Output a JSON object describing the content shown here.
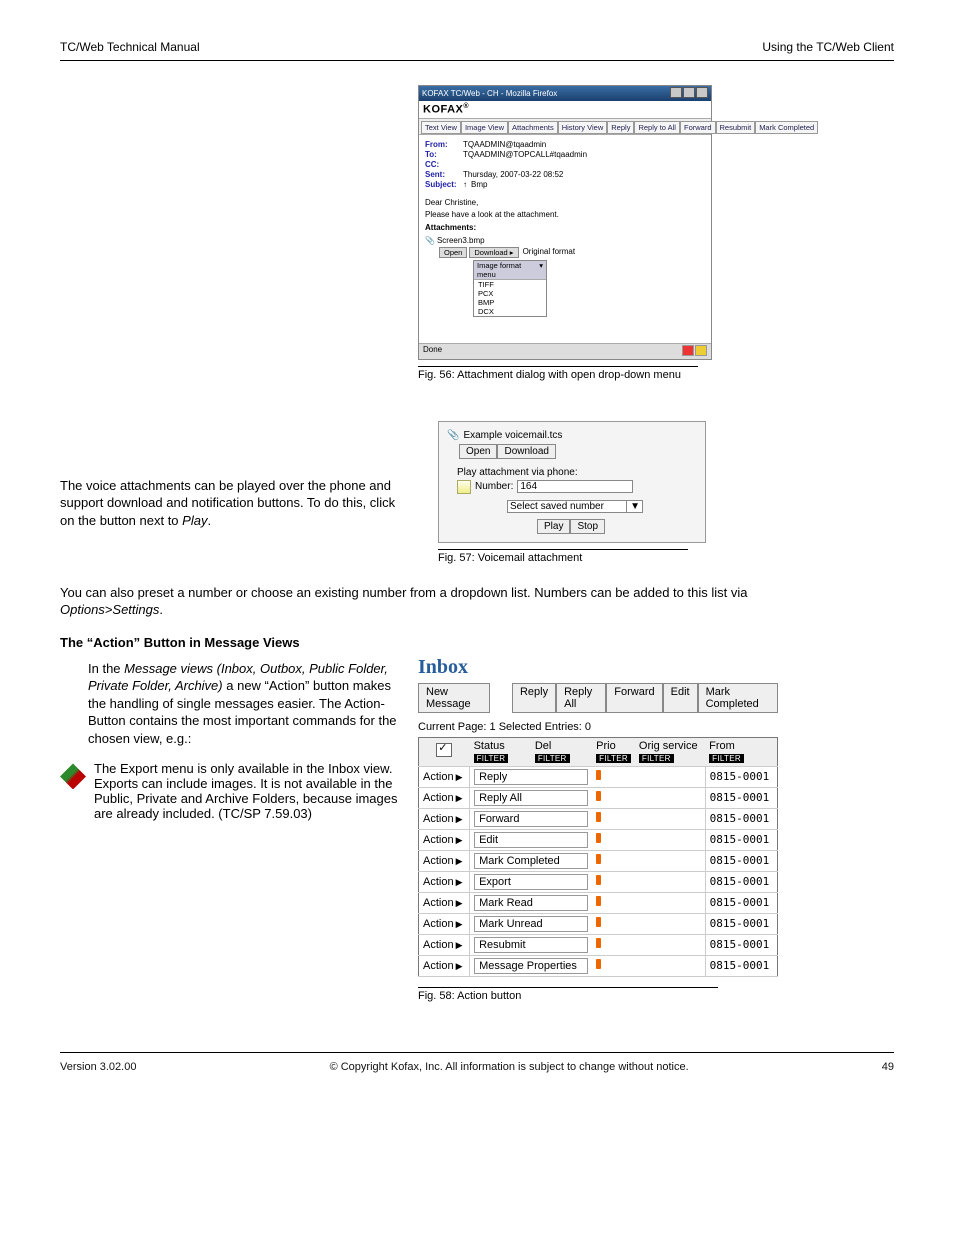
{
  "header": {
    "left": "TC/Web  Technical Manual",
    "right": "Using the TC/Web Client"
  },
  "footer": {
    "left": "Version 3.02.00",
    "center": "© Copyright Kofax, Inc.  All information is subject to change without notice.",
    "right": "49"
  },
  "fig56": {
    "title": "KOFAX TC/Web - CH - Mozilla Firefox",
    "brand": "KOFAX",
    "tabs": [
      "Text View",
      "Image View",
      "Attachments",
      "History View"
    ],
    "actions": [
      "Reply",
      "Reply to All",
      "Forward",
      "Resubmit",
      "Mark Completed"
    ],
    "meta": {
      "from_label": "From:",
      "from": "TQAADMIN@tqaadmin",
      "to_label": "To:",
      "to": "TQAADMIN@TOPCALL#tqaadmin",
      "cc_label": "CC:",
      "sent_label": "Sent:",
      "sent": "Thursday, 2007-03-22 08:52",
      "subj_label": "Subject:",
      "subj": "Bmp"
    },
    "body_line1": "Dear Christine,",
    "body_line2": "Please have a look at the attachment.",
    "att_heading": "Attachments:",
    "att_name": "Screen3.bmp",
    "open_btn": "Open",
    "download_btn": "Download",
    "orig": "Original format",
    "drop_head": "Image format menu",
    "drop_opts": [
      "TIFF",
      "PCX",
      "BMP",
      "DCX"
    ],
    "status": "Done",
    "caption": "Fig. 56: Attachment dialog with open drop-down menu"
  },
  "leftA1": "The voice attachments can be played over the phone and support download and notification buttons. To do this, click on the button next to",
  "leftA1_em": "Play",
  "leftA1_tail": ".",
  "fig57": {
    "name": "Example voicemail.tcs",
    "open": "Open",
    "download": "Download",
    "label": "Play attachment via phone:",
    "num_label": "Number:",
    "num_value": "164",
    "select": "Select saved number",
    "play": "Play",
    "stop": "Stop",
    "caption": "Fig. 57: Voicemail attachment"
  },
  "mid1": "You can also preset a number or choose an existing number from a dropdown list. Numbers can be added to this list via",
  "mid1_em": "Options>Settings",
  "mid1_tail": ".",
  "sec_action": "The “Action” Button in Message Views",
  "leftB1_pre": "In the",
  "leftB1_em": "Message views (Inbox, Outbox, Public Folder, Private Folder, Archive)",
  "leftB1_post": " a new “Action” button makes the handling of single messages easier. The Action-Button contains the most important commands for the chosen view, e.g.:",
  "inbox": {
    "title": "Inbox",
    "new": "New Message",
    "btns": [
      "Reply",
      "Reply All",
      "Forward",
      "Edit",
      "Mark Completed"
    ],
    "status": "Current Page: 1     Selected Entries: 0",
    "cols": {
      "status": "Status",
      "del": "Del",
      "prio": "Prio",
      "orig": "Orig service",
      "from": "From"
    },
    "filter": "FILTER",
    "action": "Action",
    "cmds": [
      "Reply",
      "Reply All",
      "Forward",
      "Edit",
      "Mark Completed",
      "Export",
      "Mark Read",
      "Mark Unread",
      "Resubmit",
      "Message Properties"
    ],
    "from_val": "0815-0001",
    "caption": "Fig. 58: Action button"
  },
  "note": "The Export menu is only available in the Inbox view. Exports can include images. It is not available in the Public, Private and Archive Folders, because images are already included. (TC/SP 7.59.03)"
}
